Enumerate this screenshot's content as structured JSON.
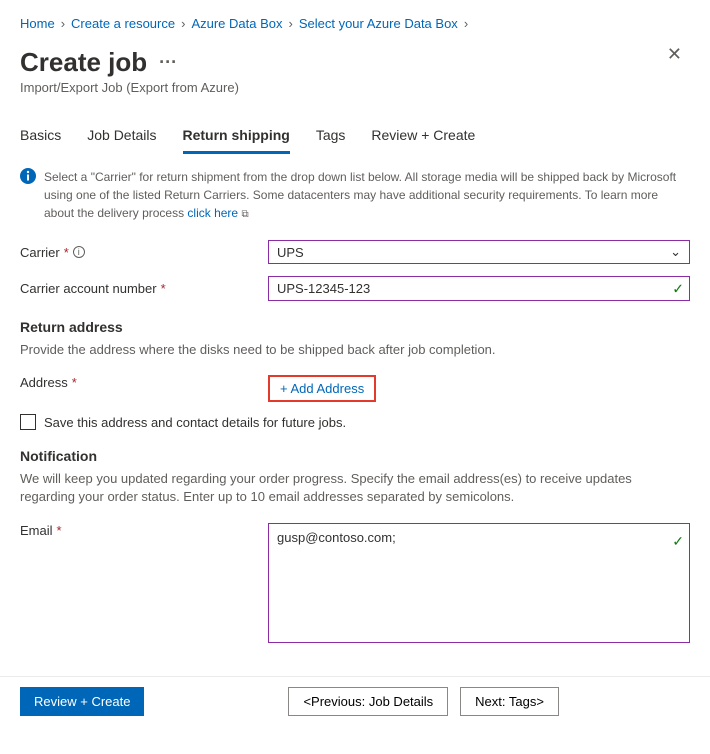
{
  "breadcrumb": [
    {
      "label": "Home"
    },
    {
      "label": "Create a resource"
    },
    {
      "label": "Azure Data Box"
    },
    {
      "label": "Select your Azure Data Box"
    }
  ],
  "title": "Create job",
  "ellipsis": "···",
  "subtitle": "Import/Export Job (Export from Azure)",
  "tabs": [
    {
      "label": "Basics",
      "active": false
    },
    {
      "label": "Job Details",
      "active": false
    },
    {
      "label": "Return shipping",
      "active": true
    },
    {
      "label": "Tags",
      "active": false
    },
    {
      "label": "Review + Create",
      "active": false
    }
  ],
  "info": {
    "text": "Select a \"Carrier\" for return shipment from the drop down list below. All storage media will be shipped back by Microsoft using one of the listed Return Carriers. Some datacenters may have additional security requirements. To learn more about the delivery process ",
    "link": "click here"
  },
  "carrier": {
    "label": "Carrier",
    "value": "UPS"
  },
  "account": {
    "label": "Carrier account number",
    "value": "UPS-12345-123"
  },
  "return_section": {
    "head": "Return address",
    "desc": "Provide the address where the disks need to be shipped back after job completion.",
    "address_label": "Address",
    "add_button": "+ Add Address",
    "checkbox_label": "Save this address and contact details for future jobs."
  },
  "notification": {
    "head": "Notification",
    "desc": "We will keep you updated regarding your order progress. Specify the email address(es) to receive updates regarding your order status. Enter up to 10 email addresses separated by semicolons.",
    "email_label": "Email",
    "email_value": "gusp@contoso.com;"
  },
  "footer": {
    "review": "Review + Create",
    "prev": "<Previous: Job Details",
    "next": "Next: Tags>"
  }
}
